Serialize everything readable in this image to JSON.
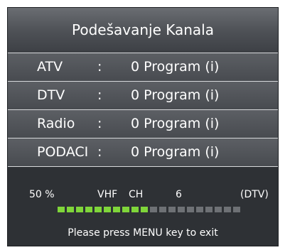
{
  "dialog": {
    "title": "Podešavanje Kanala",
    "rows": [
      {
        "name": "ATV",
        "colon": ":",
        "value": "0 Program (i)"
      },
      {
        "name": "DTV",
        "colon": ":",
        "value": "0 Program (i)"
      },
      {
        "name": "Radio",
        "colon": ":",
        "value": "0 Program (i)"
      },
      {
        "name": "PODACI",
        "colon": ":",
        "value": "0 Program (i)"
      }
    ],
    "status": {
      "percent": "50 %",
      "band": "VHF",
      "ch_label": "CH",
      "channel": "6",
      "mode": "(DTV)"
    },
    "progress": {
      "fraction": 0.5,
      "total_segments": 20,
      "filled_color": "#7fd53a",
      "empty_color": "#6e7175"
    },
    "hint": "Please press MENU key to exit"
  },
  "colors": {
    "panel_bg": "#2e3135",
    "row_bg": "#55585d",
    "text": "#ffffff"
  }
}
